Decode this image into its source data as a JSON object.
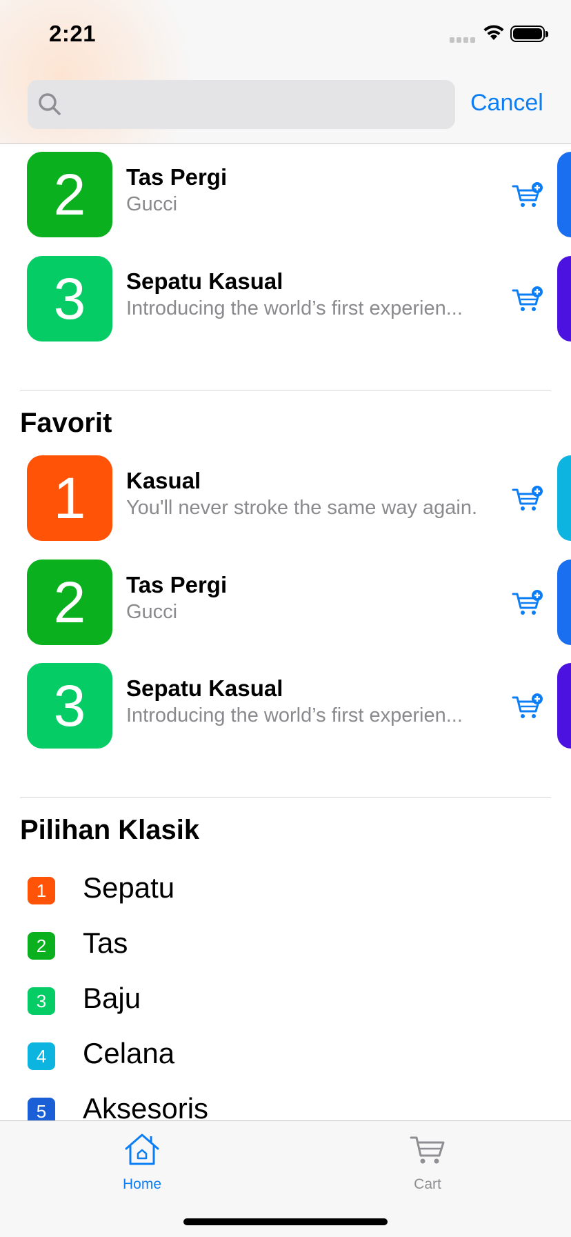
{
  "status_bar": {
    "time": "2:21"
  },
  "search": {
    "placeholder": "",
    "cancel_label": "Cancel"
  },
  "top_items": [
    {
      "number": "2",
      "title": "Tas Pergi",
      "subtitle": "Gucci",
      "color": "#0bb01e",
      "peek_color": "#1a6ef0"
    },
    {
      "number": "3",
      "title": "Sepatu Kasual",
      "subtitle": "Introducing the world’s first experien...",
      "color": "#06cc66",
      "peek_color": "#4b12e0"
    }
  ],
  "favorit": {
    "title": "Favorit",
    "items": [
      {
        "number": "1",
        "title": "Kasual",
        "subtitle": "You'll never stroke the same way again.",
        "color": "#ff5307",
        "peek_color": "#0cb4df"
      },
      {
        "number": "2",
        "title": "Tas Pergi",
        "subtitle": "Gucci",
        "color": "#0bb01e",
        "peek_color": "#1a6ef0"
      },
      {
        "number": "3",
        "title": "Sepatu Kasual",
        "subtitle": "Introducing the world’s first experien...",
        "color": "#06cc66",
        "peek_color": "#4b12e0"
      }
    ]
  },
  "pilihan_klasik": {
    "title": "Pilihan Klasik",
    "items": [
      {
        "number": "1",
        "label": "Sepatu",
        "color": "#ff5307"
      },
      {
        "number": "2",
        "label": "Tas",
        "color": "#0bb01e"
      },
      {
        "number": "3",
        "label": "Baju",
        "color": "#06cc66"
      },
      {
        "number": "4",
        "label": "Celana",
        "color": "#0cb4df"
      },
      {
        "number": "5",
        "label": "Aksesoris",
        "color": "#1a5fd6"
      }
    ]
  },
  "tabbar": {
    "home_label": "Home",
    "cart_label": "Cart",
    "active_color": "#0b7ef6",
    "inactive_color": "#8e8e93"
  },
  "icons": {
    "search": "search-icon",
    "cart_add": "cart-add-icon",
    "home": "home-icon",
    "cart": "cart-icon"
  }
}
